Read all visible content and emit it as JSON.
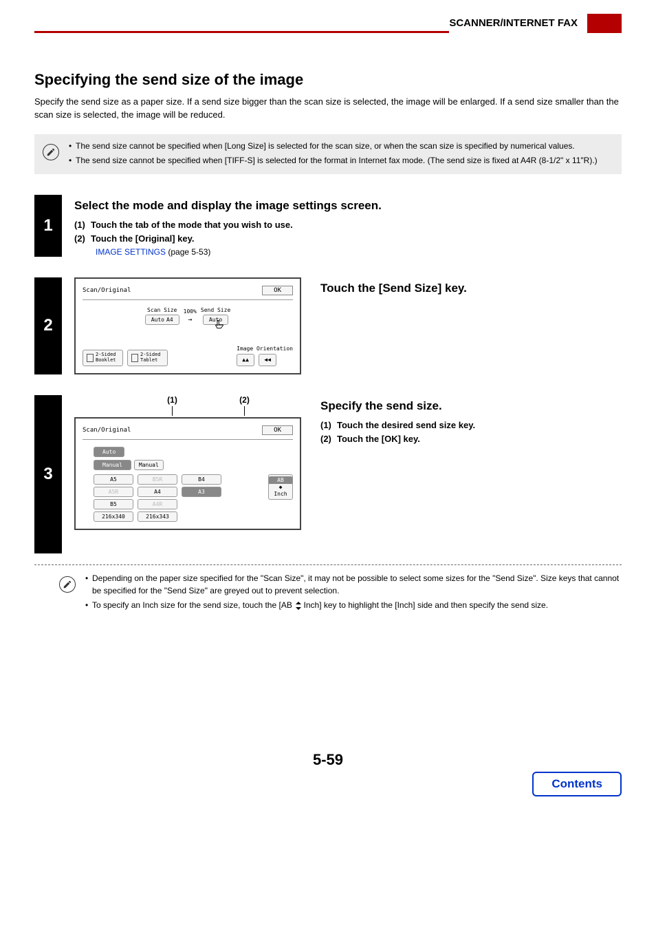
{
  "header": {
    "title": "SCANNER/INTERNET FAX"
  },
  "h1": "Specifying the send size of the image",
  "intro": "Specify the send size as a paper size. If a send size bigger than the scan size is selected, the image will be enlarged. If a send size smaller than the scan size is selected, the image will be reduced.",
  "notes_top": {
    "a": "The send size cannot be specified when [Long Size] is selected for the scan size, or when the scan size is specified by numerical values.",
    "b": "The send size cannot be specified when [TIFF-S] is selected for the format in Internet fax mode. (The send size is fixed at A4R (8-1/2\" x 11\"R).)"
  },
  "step1": {
    "num": "1",
    "title": "Select the mode and display the image settings screen.",
    "sub1_num": "(1)",
    "sub1_text": "Touch the tab of the mode that you wish to use.",
    "sub2_num": "(2)",
    "sub2_text": "Touch the [Original] key.",
    "link": "IMAGE SETTINGS",
    "link_page": " (page 5-53)"
  },
  "step2": {
    "num": "2",
    "title": "Touch the [Send Size] key.",
    "panel": {
      "breadcrumb": "Scan/Original",
      "ok": "OK",
      "scan_label": "Scan Size",
      "scan_auto": "Auto",
      "scan_size": "A4",
      "ratio": "100%",
      "send_label": "Send Size",
      "send_auto": "Auto",
      "btn_booklet": "2-Sided Booklet",
      "btn_tablet": "2-Sided Tablet",
      "orient_label": "Image Orientation"
    }
  },
  "step3": {
    "num": "3",
    "title": "Specify the send size.",
    "sub1_num": "(1)",
    "sub1_text": "Touch the desired send size key.",
    "sub2_num": "(2)",
    "sub2_text": "Touch the [OK] key.",
    "callout1": "(1)",
    "callout2": "(2)",
    "panel": {
      "breadcrumb": "Scan/Original",
      "ok": "OK",
      "tab_auto": "Auto",
      "tab_manual": "Manual",
      "tab_manual2": "Manual",
      "sizes": {
        "a5": "A5",
        "b5r": "B5R",
        "b4": "B4",
        "a5r": "A5R",
        "a4": "A4",
        "a3": "A3",
        "b5": "B5",
        "a4r": "A4R",
        "s1": "216x340",
        "s2": "216x343"
      },
      "ab": "AB",
      "inch": "Inch"
    },
    "notes": {
      "a": "Depending on the paper size specified for the \"Scan Size\", it may not be possible to select some sizes for the \"Send Size\". Size keys that cannot be specified for the \"Send Size\" are greyed out to prevent selection.",
      "b_pre": "To specify an Inch size for the send size, touch the [AB",
      "b_post": "Inch] key to highlight the [Inch] side and then specify the send size."
    }
  },
  "page_num": "5-59",
  "contents": "Contents"
}
